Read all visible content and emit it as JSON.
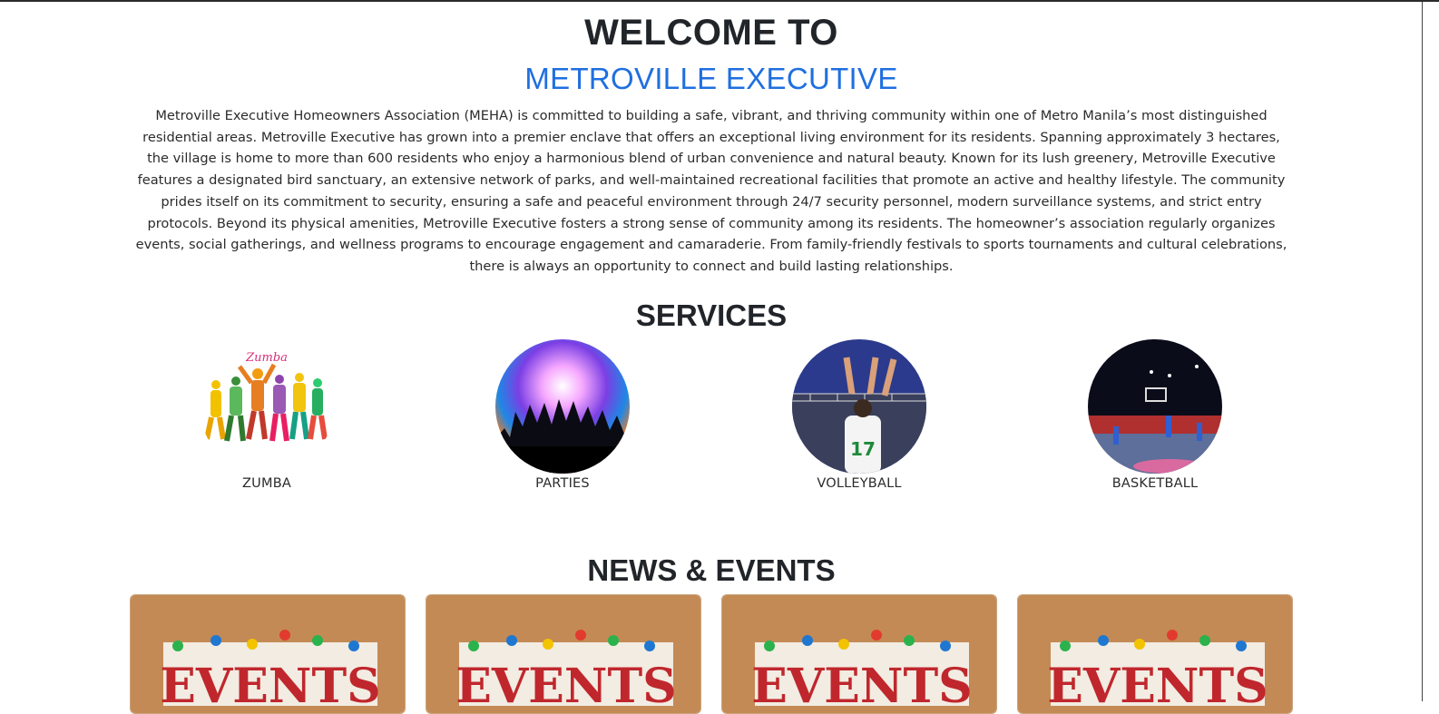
{
  "hero": {
    "welcome": "WELCOME TO",
    "brand": "METROVILLE EXECUTIVE",
    "intro": "Metroville Executive Homeowners Association (MEHA) is committed to building a safe, vibrant, and thriving community within one of Metro Manila’s most distinguished residential areas. Metroville Executive has grown into a premier enclave that offers an exceptional living environment for its residents. Spanning approximately 3 hectares, the village is home to more than 600 residents who enjoy a harmonious blend of urban convenience and natural beauty. Known for its lush greenery, Metroville Executive features a designated bird sanctuary, an extensive network of parks, and well-maintained recreational facilities that promote an active and healthy lifestyle. The community prides itself on its commitment to security, ensuring a safe and peaceful environment through 24/7 security personnel, modern surveillance systems, and strict entry protocols. Beyond its physical amenities, Metroville Executive fosters a strong sense of community among its residents. The homeowner’s association regularly organizes events, social gatherings, and wellness programs to encourage engagement and camaraderie. From family-friendly festivals to sports tournaments and cultural celebrations, there is always an opportunity to connect and build lasting relationships."
  },
  "services": {
    "title": "SERVICES",
    "items": [
      {
        "label": "ZUMBA",
        "image_text": "Zumba"
      },
      {
        "label": "PARTIES"
      },
      {
        "label": "VOLLEYBALL",
        "jersey_number": "17"
      },
      {
        "label": "BASKETBALL"
      }
    ]
  },
  "news": {
    "title": "NEWS & EVENTS",
    "cards": [
      {
        "image_text": "EVENTS"
      },
      {
        "image_text": "EVENTS"
      },
      {
        "image_text": "EVENTS"
      },
      {
        "image_text": "EVENTS"
      }
    ]
  },
  "colors": {
    "brand_blue": "#1f6fe0",
    "heading": "#212529",
    "cork": "#c48a55"
  }
}
